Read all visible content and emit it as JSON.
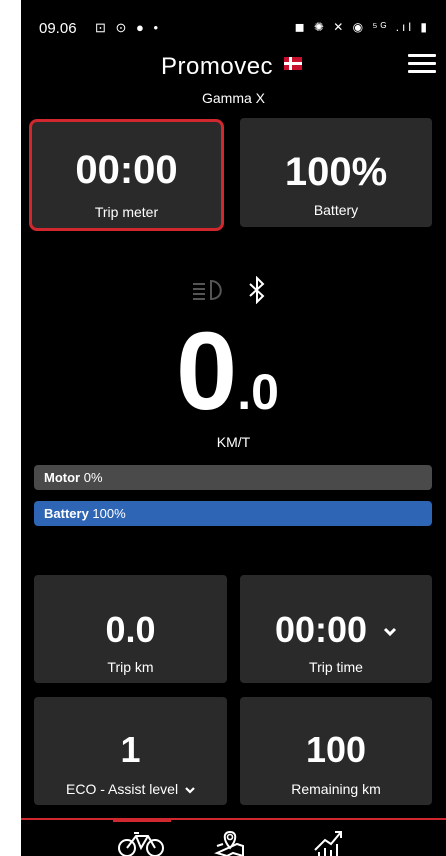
{
  "status_bar": {
    "time": "09.06",
    "left_icons": "⊡ ⊙ ● •",
    "right_icons": "◼ ✺ ✕ ◉ ⁵ᴳ .ıl ▮"
  },
  "header": {
    "logo_text": "Promovec",
    "model": "Gamma X"
  },
  "tiles": {
    "trip_meter": {
      "value": "00:00",
      "label": "Trip meter"
    },
    "battery": {
      "value": "100%",
      "label": "Battery"
    },
    "trip_km": {
      "value": "0.0",
      "label": "Trip km"
    },
    "trip_time": {
      "value": "00:00",
      "label": "Trip time"
    },
    "assist": {
      "value": "1",
      "label": "ECO - Assist level"
    },
    "remaining": {
      "value": "100",
      "label": "Remaining km"
    }
  },
  "speed": {
    "integer": "0",
    "decimal": ".0",
    "unit": "KM/T"
  },
  "bars": {
    "motor": {
      "label": "Motor",
      "value": "0%",
      "fraction": 0.0,
      "color": "#4a4a4a"
    },
    "battery": {
      "label": "Battery",
      "value": "100%",
      "fraction": 1.0,
      "color": "#2f65b5"
    }
  },
  "colors": {
    "accent": "#d0282e",
    "tile": "#2a2a2a",
    "battery_bar": "#2f65b5"
  },
  "nav": {
    "items": [
      "bike-icon",
      "map-icon",
      "stats-icon"
    ],
    "active": "bike-icon"
  }
}
